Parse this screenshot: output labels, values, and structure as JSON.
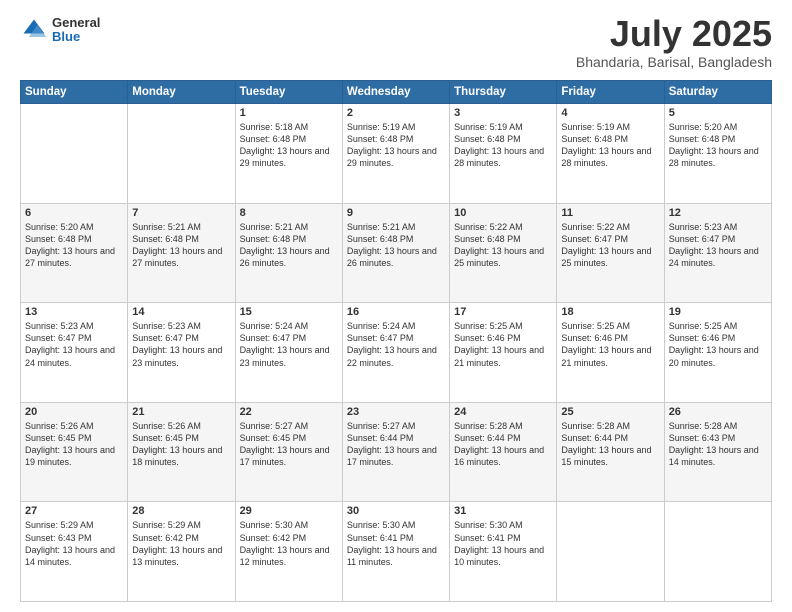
{
  "header": {
    "logo_general": "General",
    "logo_blue": "Blue",
    "title": "July 2025",
    "location": "Bhandaria, Barisal, Bangladesh"
  },
  "weekdays": [
    "Sunday",
    "Monday",
    "Tuesday",
    "Wednesday",
    "Thursday",
    "Friday",
    "Saturday"
  ],
  "weeks": [
    [
      {
        "day": "",
        "sunrise": "",
        "sunset": "",
        "daylight": ""
      },
      {
        "day": "",
        "sunrise": "",
        "sunset": "",
        "daylight": ""
      },
      {
        "day": "1",
        "sunrise": "Sunrise: 5:18 AM",
        "sunset": "Sunset: 6:48 PM",
        "daylight": "Daylight: 13 hours and 29 minutes."
      },
      {
        "day": "2",
        "sunrise": "Sunrise: 5:19 AM",
        "sunset": "Sunset: 6:48 PM",
        "daylight": "Daylight: 13 hours and 29 minutes."
      },
      {
        "day": "3",
        "sunrise": "Sunrise: 5:19 AM",
        "sunset": "Sunset: 6:48 PM",
        "daylight": "Daylight: 13 hours and 28 minutes."
      },
      {
        "day": "4",
        "sunrise": "Sunrise: 5:19 AM",
        "sunset": "Sunset: 6:48 PM",
        "daylight": "Daylight: 13 hours and 28 minutes."
      },
      {
        "day": "5",
        "sunrise": "Sunrise: 5:20 AM",
        "sunset": "Sunset: 6:48 PM",
        "daylight": "Daylight: 13 hours and 28 minutes."
      }
    ],
    [
      {
        "day": "6",
        "sunrise": "Sunrise: 5:20 AM",
        "sunset": "Sunset: 6:48 PM",
        "daylight": "Daylight: 13 hours and 27 minutes."
      },
      {
        "day": "7",
        "sunrise": "Sunrise: 5:21 AM",
        "sunset": "Sunset: 6:48 PM",
        "daylight": "Daylight: 13 hours and 27 minutes."
      },
      {
        "day": "8",
        "sunrise": "Sunrise: 5:21 AM",
        "sunset": "Sunset: 6:48 PM",
        "daylight": "Daylight: 13 hours and 26 minutes."
      },
      {
        "day": "9",
        "sunrise": "Sunrise: 5:21 AM",
        "sunset": "Sunset: 6:48 PM",
        "daylight": "Daylight: 13 hours and 26 minutes."
      },
      {
        "day": "10",
        "sunrise": "Sunrise: 5:22 AM",
        "sunset": "Sunset: 6:48 PM",
        "daylight": "Daylight: 13 hours and 25 minutes."
      },
      {
        "day": "11",
        "sunrise": "Sunrise: 5:22 AM",
        "sunset": "Sunset: 6:47 PM",
        "daylight": "Daylight: 13 hours and 25 minutes."
      },
      {
        "day": "12",
        "sunrise": "Sunrise: 5:23 AM",
        "sunset": "Sunset: 6:47 PM",
        "daylight": "Daylight: 13 hours and 24 minutes."
      }
    ],
    [
      {
        "day": "13",
        "sunrise": "Sunrise: 5:23 AM",
        "sunset": "Sunset: 6:47 PM",
        "daylight": "Daylight: 13 hours and 24 minutes."
      },
      {
        "day": "14",
        "sunrise": "Sunrise: 5:23 AM",
        "sunset": "Sunset: 6:47 PM",
        "daylight": "Daylight: 13 hours and 23 minutes."
      },
      {
        "day": "15",
        "sunrise": "Sunrise: 5:24 AM",
        "sunset": "Sunset: 6:47 PM",
        "daylight": "Daylight: 13 hours and 23 minutes."
      },
      {
        "day": "16",
        "sunrise": "Sunrise: 5:24 AM",
        "sunset": "Sunset: 6:47 PM",
        "daylight": "Daylight: 13 hours and 22 minutes."
      },
      {
        "day": "17",
        "sunrise": "Sunrise: 5:25 AM",
        "sunset": "Sunset: 6:46 PM",
        "daylight": "Daylight: 13 hours and 21 minutes."
      },
      {
        "day": "18",
        "sunrise": "Sunrise: 5:25 AM",
        "sunset": "Sunset: 6:46 PM",
        "daylight": "Daylight: 13 hours and 21 minutes."
      },
      {
        "day": "19",
        "sunrise": "Sunrise: 5:25 AM",
        "sunset": "Sunset: 6:46 PM",
        "daylight": "Daylight: 13 hours and 20 minutes."
      }
    ],
    [
      {
        "day": "20",
        "sunrise": "Sunrise: 5:26 AM",
        "sunset": "Sunset: 6:45 PM",
        "daylight": "Daylight: 13 hours and 19 minutes."
      },
      {
        "day": "21",
        "sunrise": "Sunrise: 5:26 AM",
        "sunset": "Sunset: 6:45 PM",
        "daylight": "Daylight: 13 hours and 18 minutes."
      },
      {
        "day": "22",
        "sunrise": "Sunrise: 5:27 AM",
        "sunset": "Sunset: 6:45 PM",
        "daylight": "Daylight: 13 hours and 17 minutes."
      },
      {
        "day": "23",
        "sunrise": "Sunrise: 5:27 AM",
        "sunset": "Sunset: 6:44 PM",
        "daylight": "Daylight: 13 hours and 17 minutes."
      },
      {
        "day": "24",
        "sunrise": "Sunrise: 5:28 AM",
        "sunset": "Sunset: 6:44 PM",
        "daylight": "Daylight: 13 hours and 16 minutes."
      },
      {
        "day": "25",
        "sunrise": "Sunrise: 5:28 AM",
        "sunset": "Sunset: 6:44 PM",
        "daylight": "Daylight: 13 hours and 15 minutes."
      },
      {
        "day": "26",
        "sunrise": "Sunrise: 5:28 AM",
        "sunset": "Sunset: 6:43 PM",
        "daylight": "Daylight: 13 hours and 14 minutes."
      }
    ],
    [
      {
        "day": "27",
        "sunrise": "Sunrise: 5:29 AM",
        "sunset": "Sunset: 6:43 PM",
        "daylight": "Daylight: 13 hours and 14 minutes."
      },
      {
        "day": "28",
        "sunrise": "Sunrise: 5:29 AM",
        "sunset": "Sunset: 6:42 PM",
        "daylight": "Daylight: 13 hours and 13 minutes."
      },
      {
        "day": "29",
        "sunrise": "Sunrise: 5:30 AM",
        "sunset": "Sunset: 6:42 PM",
        "daylight": "Daylight: 13 hours and 12 minutes."
      },
      {
        "day": "30",
        "sunrise": "Sunrise: 5:30 AM",
        "sunset": "Sunset: 6:41 PM",
        "daylight": "Daylight: 13 hours and 11 minutes."
      },
      {
        "day": "31",
        "sunrise": "Sunrise: 5:30 AM",
        "sunset": "Sunset: 6:41 PM",
        "daylight": "Daylight: 13 hours and 10 minutes."
      },
      {
        "day": "",
        "sunrise": "",
        "sunset": "",
        "daylight": ""
      },
      {
        "day": "",
        "sunrise": "",
        "sunset": "",
        "daylight": ""
      }
    ]
  ]
}
